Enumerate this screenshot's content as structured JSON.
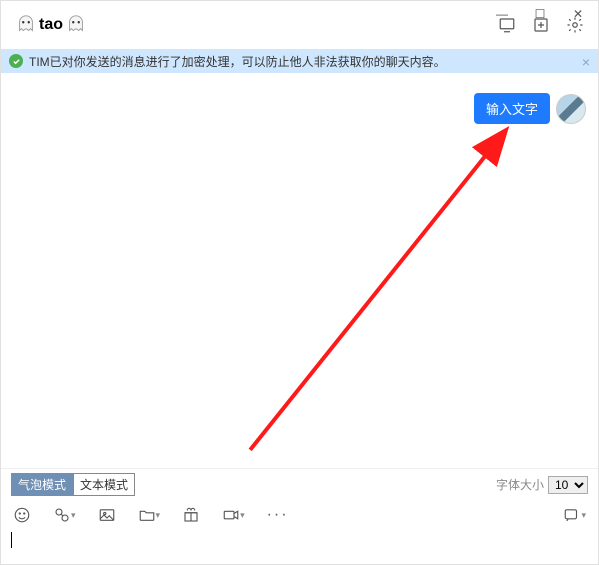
{
  "window": {
    "minimize": "—",
    "maximize": "☐",
    "close": "✕"
  },
  "header": {
    "title_text": "tao"
  },
  "banner": {
    "text": "TIM已对你发送的消息进行了加密处理，可以防止他人非法获取你的聊天内容。"
  },
  "chat": {
    "messages": [
      {
        "side": "right",
        "text": "输入文字"
      }
    ]
  },
  "modes": {
    "bubble": "气泡模式",
    "text": "文本模式",
    "font_label": "字体大小",
    "font_value": "10"
  },
  "toolbar": {
    "emoji": "emoji",
    "cut": "cut",
    "image": "image",
    "folder": "folder",
    "gift": "gift",
    "video": "video",
    "more": "···"
  }
}
